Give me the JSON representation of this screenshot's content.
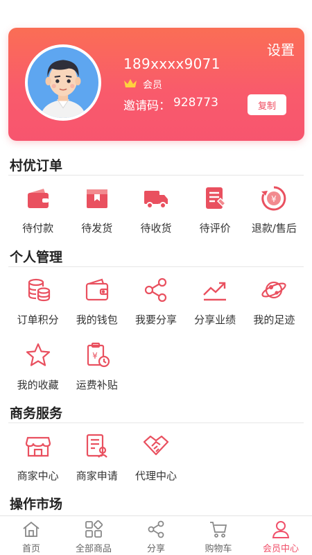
{
  "colors": {
    "accent": "#f0506a",
    "card_top": "#fa6e55",
    "card_bottom": "#f7556f",
    "icon": "#e9505f"
  },
  "profile": {
    "settings_label": "设置",
    "phone": "189xxxx9071",
    "member_label": "会员",
    "invite_label": "邀请码：",
    "invite_code": "928773",
    "copy_label": "复制"
  },
  "orders": {
    "title": "村优订单",
    "items": [
      {
        "label": "待付款",
        "icon": "wallet-icon"
      },
      {
        "label": "待发货",
        "icon": "package-icon"
      },
      {
        "label": "待收货",
        "icon": "truck-icon"
      },
      {
        "label": "待评价",
        "icon": "review-icon"
      },
      {
        "label": "退款/售后",
        "icon": "refund-icon"
      }
    ]
  },
  "personal": {
    "title": "个人管理",
    "items": [
      {
        "label": "订单积分",
        "icon": "coins-icon"
      },
      {
        "label": "我的钱包",
        "icon": "wallet-icon"
      },
      {
        "label": "我要分享",
        "icon": "share-icon"
      },
      {
        "label": "分享业绩",
        "icon": "trend-icon"
      },
      {
        "label": "我的足迹",
        "icon": "planet-icon"
      },
      {
        "label": "我的收藏",
        "icon": "star-icon"
      },
      {
        "label": "运费补贴",
        "icon": "subsidy-icon"
      }
    ]
  },
  "business": {
    "title": "商务服务",
    "items": [
      {
        "label": "商家中心",
        "icon": "store-icon"
      },
      {
        "label": "商家申请",
        "icon": "application-icon"
      },
      {
        "label": "代理中心",
        "icon": "handshake-icon"
      }
    ]
  },
  "operations": {
    "title": "操作市场"
  },
  "tabbar": {
    "items": [
      {
        "label": "首页",
        "icon": "home-icon",
        "active": false
      },
      {
        "label": "全部商品",
        "icon": "grid-icon",
        "active": false
      },
      {
        "label": "分享",
        "icon": "share-icon",
        "active": false
      },
      {
        "label": "购物车",
        "icon": "cart-icon",
        "active": false
      },
      {
        "label": "会员中心",
        "icon": "user-icon",
        "active": true
      }
    ]
  }
}
